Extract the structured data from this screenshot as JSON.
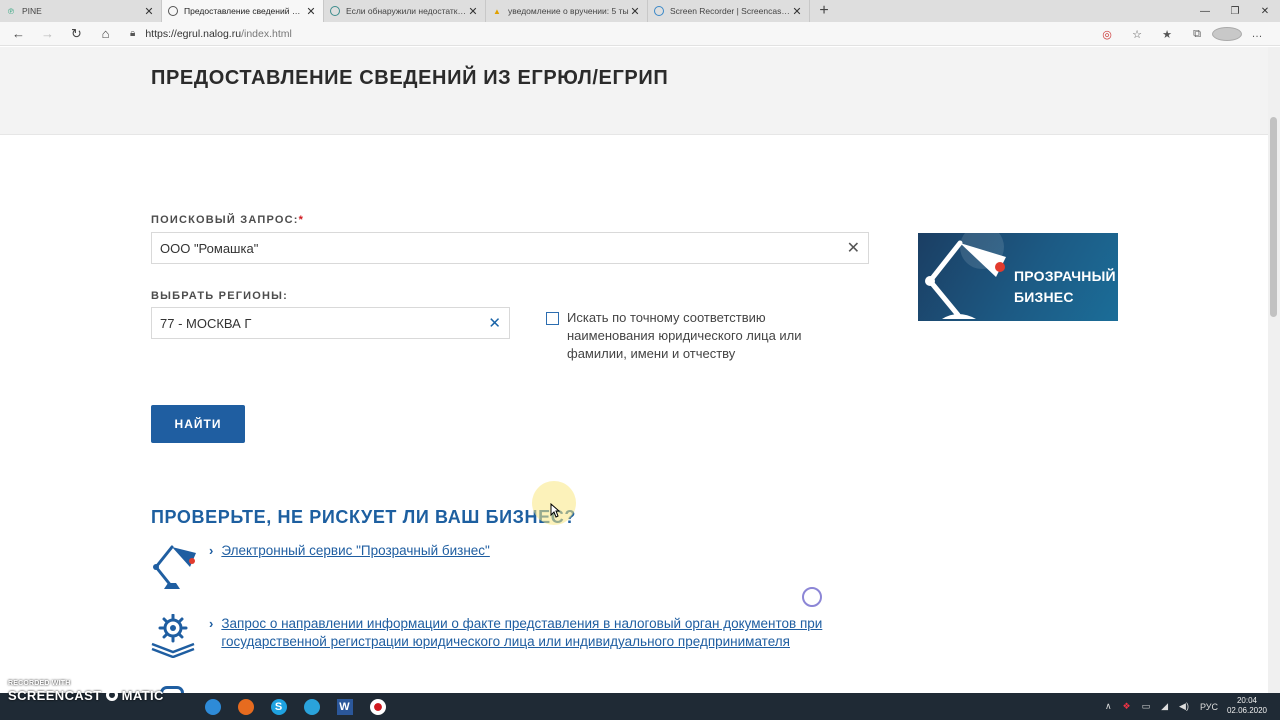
{
  "browser": {
    "tabs": [
      {
        "title": "PINE",
        "active": false
      },
      {
        "title": "Предоставление сведений из Е",
        "active": true
      },
      {
        "title": "Если обнаружили недостатки и",
        "active": false
      },
      {
        "title": "уведомление о вручении: 5 ты",
        "active": false
      },
      {
        "title": "Screen Recorder | Screencast-O",
        "active": false
      }
    ],
    "url_host": "https://egrul.nalog.ru",
    "url_path": "/index.html"
  },
  "page": {
    "title": "ПРЕДОСТАВЛЕНИЕ СВЕДЕНИЙ ИЗ ЕГРЮЛ/ЕГРИП",
    "search": {
      "label": "ПОИСКОВЫЙ ЗАПРОС:",
      "required_mark": "*",
      "value": "ООО \"Ромашка\""
    },
    "region": {
      "label": "ВЫБРАТЬ РЕГИОНЫ:",
      "value": "77 - МОСКВА Г"
    },
    "exact_match": {
      "checked": false,
      "label": "Искать по точному соответствию наименования юридического лица или фамилии, имени и отчеству"
    },
    "find_button": "НАЙТИ",
    "banner_text_1": "ПРОЗРАЧНЫЙ",
    "banner_text_2": "БИЗНЕС",
    "risk_title": "ПРОВЕРЬТЕ, НЕ РИСКУЕТ ЛИ ВАШ БИЗНЕС?",
    "services": [
      {
        "label": "Электронный сервис \"Прозрачный бизнес\""
      },
      {
        "label": "Запрос о направлении информации о факте представления в налоговый орган документов при государственной регистрации юридического лица или индивидуального предпринимателя"
      }
    ]
  },
  "overlay": {
    "watermark_small": "RECORDED WITH",
    "watermark_big": "SCREENCAST",
    "watermark_suffix": "MATIC"
  },
  "taskbar": {
    "lang": "РУС",
    "time": "20:04",
    "date": "02.06.2020"
  },
  "colors": {
    "brand_blue": "#1f5ea1",
    "required_red": "#d0191f",
    "banner_bg": "#1c5a84"
  }
}
